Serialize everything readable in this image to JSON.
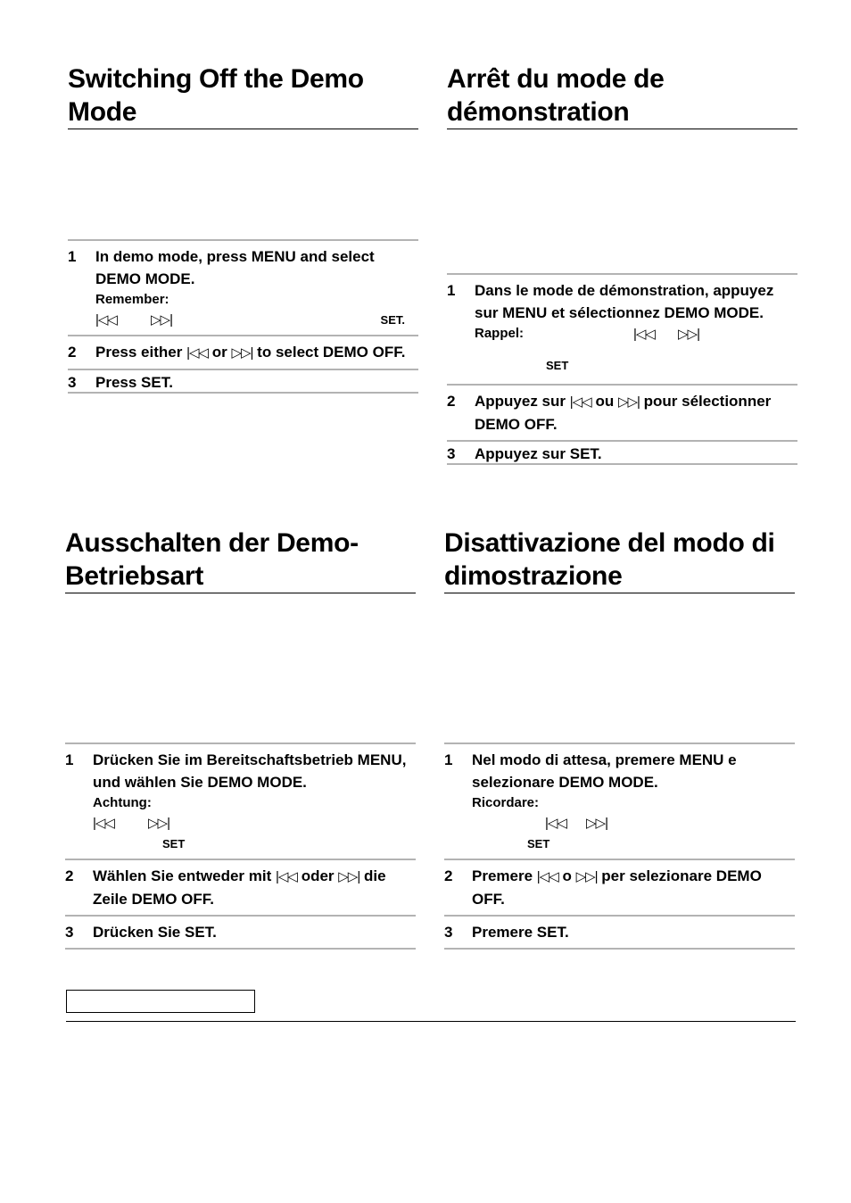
{
  "glyphs": {
    "prev": "⏮",
    "next": "⏭",
    "prev_text": "|◁◁",
    "next_text": "▷▷|"
  },
  "sections": {
    "en": {
      "title": "Switching Off the Demo Mode",
      "step1": {
        "num": "1",
        "text": "In demo mode, press MENU and select DEMO MODE.",
        "note_label": "Remember:",
        "set_label": "SET."
      },
      "step2": {
        "num": "2",
        "pre": "Press either ",
        "mid": " or ",
        "post": " to select DEMO OFF."
      },
      "step3": {
        "num": "3",
        "text": "Press SET."
      }
    },
    "fr": {
      "title": "Arrêt du mode de démonstration",
      "step1": {
        "num": "1",
        "text": "Dans le mode de démonstration, appuyez sur MENU et sélectionnez DEMO MODE.",
        "note_label": "Rappel:",
        "set_label": "SET"
      },
      "step2": {
        "num": "2",
        "pre": "Appuyez sur ",
        "mid": " ou ",
        "post": " pour sélectionner DEMO OFF."
      },
      "step3": {
        "num": "3",
        "text": "Appuyez sur SET."
      }
    },
    "de": {
      "title": "Ausschalten der Demo-Betriebsart",
      "step1": {
        "num": "1",
        "text": "Drücken Sie im Bereitschaftsbetrieb MENU, und wählen Sie DEMO MODE.",
        "note_label": "Achtung:",
        "set_label": "SET"
      },
      "step2": {
        "num": "2",
        "pre": "Wählen Sie entweder mit ",
        "mid": " oder ",
        "post": " die Zeile DEMO OFF."
      },
      "step3": {
        "num": "3",
        "text": "Drücken Sie SET."
      }
    },
    "it": {
      "title": "Disattivazione del modo di dimostrazione",
      "step1": {
        "num": "1",
        "text": "Nel modo di attesa, premere MENU e selezionare DEMO MODE.",
        "note_label": "Ricordare:",
        "set_label": "SET"
      },
      "step2": {
        "num": "2",
        "pre": "Premere ",
        "mid": " o ",
        "post": " per selezionare DEMO OFF."
      },
      "step3": {
        "num": "3",
        "text": "Premere SET."
      }
    }
  }
}
